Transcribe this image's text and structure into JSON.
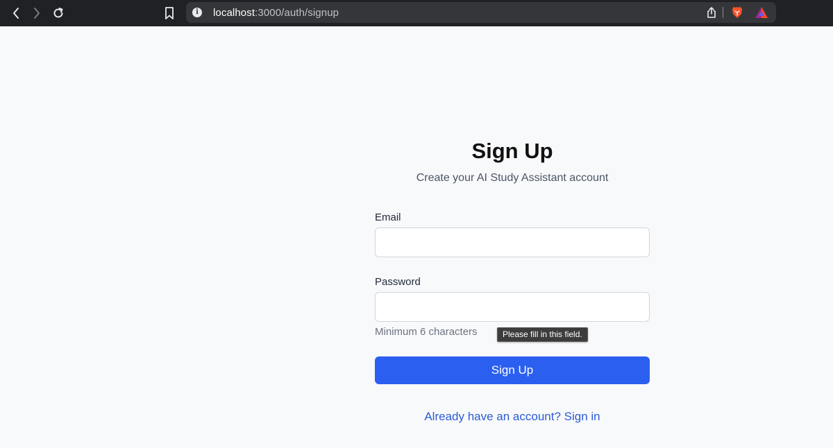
{
  "browser": {
    "url_host": "localhost",
    "url_path": ":3000/auth/signup",
    "colors": {
      "toolbar": "#202124",
      "omnibox": "#35363a"
    },
    "icons": [
      "back-icon",
      "forward-icon",
      "reload-icon",
      "bookmark-icon",
      "info-icon",
      "share-icon",
      "brave-shield-icon",
      "brave-rewards-icon"
    ]
  },
  "signup": {
    "title": "Sign Up",
    "subtitle": "Create your AI Study Assistant account",
    "email_label": "Email",
    "email_value": "",
    "password_label": "Password",
    "password_value": "",
    "password_hint": "Minimum 6 characters",
    "validation_tooltip": "Please fill in this field.",
    "submit_label": "Sign Up",
    "signin_link": "Already have an account? Sign in",
    "colors": {
      "primary": "#2b5ff0",
      "link": "#2b5bd7",
      "background": "#f8f9fb"
    }
  }
}
